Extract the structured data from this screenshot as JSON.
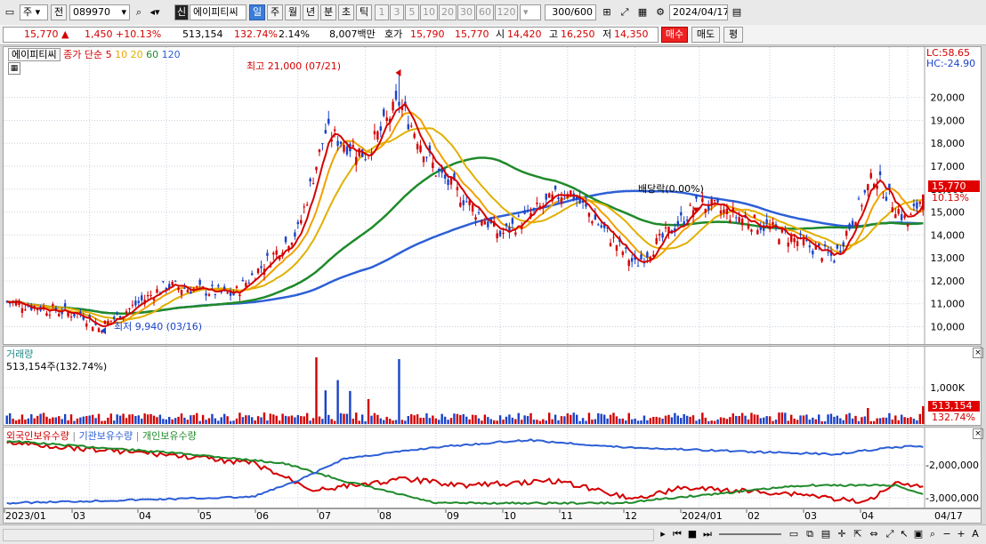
{
  "toolbar": {
    "type_select": "주",
    "prev_label": "전",
    "stock_code": "089970",
    "credit_badge": "신",
    "stock_name": "에이피티씨",
    "periods": [
      "일",
      "주",
      "월",
      "년",
      "분",
      "초",
      "틱"
    ],
    "active_period": "일",
    "minute_steps": [
      "1",
      "3",
      "5",
      "10",
      "20",
      "30",
      "60",
      "120"
    ],
    "count_current": "300",
    "count_total": "/600",
    "date": "2024/04/17"
  },
  "quote": {
    "price": "15,770",
    "change": "1,450",
    "change_pct": "+10.13%",
    "volume": "513,154",
    "volume_ratio": "132.74%",
    "turnover_rate": "2.14%",
    "amount": "8,007백만",
    "ask_label": "호가",
    "ask1": "15,790",
    "bid1": "15,770",
    "open_label": "시",
    "open": "14,420",
    "high_label": "고",
    "high": "16,250",
    "low_label": "저",
    "low": "14,350",
    "buy_label": "매수",
    "sell_label": "매도",
    "eval_label": "평"
  },
  "price_panel": {
    "stock_label": "에이피티씨",
    "ma_title": "종가 단순",
    "ma_periods": [
      {
        "label": "5",
        "color": "#d40000"
      },
      {
        "label": "10",
        "color": "#f2a000"
      },
      {
        "label": "20",
        "color": "#e0b000"
      },
      {
        "label": "60",
        "color": "#1f8a2a"
      },
      {
        "label": "120",
        "color": "#2d5fd6"
      }
    ],
    "lc_label": "LC:58.65",
    "hc_label": "HC:-24.90",
    "high_annotation": "최고 21,000 (07/21)",
    "low_annotation": "최저 9,940 (03/16)",
    "dividend_annotation": "배당락(0.00%)",
    "price_tag": "15,770",
    "pct_tag": "10.13%"
  },
  "volume_panel": {
    "title": "거래량",
    "value_label": "513,154주(132.74%)",
    "tag_value": "513,154",
    "tag_pct": "132.74%"
  },
  "holding_panel": {
    "labels": [
      "외국인보유수량",
      "기관보유수량",
      "개인보유수량"
    ],
    "colors": [
      "#d40000",
      "#2d5fd6",
      "#1f8a2a"
    ]
  },
  "colors": {
    "up": "#d40000",
    "down": "#1a43c8",
    "grid": "#c8d2e0"
  },
  "chart_data": [
    {
      "type": "candlestick",
      "title": "에이피티씨",
      "x_labels": [
        "2023/01",
        "03",
        "04",
        "05",
        "06",
        "07",
        "08",
        "09",
        "10",
        "11",
        "12",
        "2024/01",
        "02",
        "03",
        "04",
        "04/17"
      ],
      "y_ticks": [
        10000,
        11000,
        12000,
        13000,
        14000,
        15000,
        16000,
        17000,
        18000,
        19000,
        20000
      ],
      "ylim": [
        9400,
        21500
      ],
      "closing_path": [
        {
          "x": "2023/01",
          "y": 11100
        },
        {
          "x": "03",
          "y": 10500
        },
        {
          "x": "03/16",
          "y": 9940
        },
        {
          "x": "04",
          "y": 11800
        },
        {
          "x": "05",
          "y": 11400
        },
        {
          "x": "06",
          "y": 14200
        },
        {
          "x": "06-mid",
          "y": 18500
        },
        {
          "x": "07",
          "y": 17500
        },
        {
          "x": "07/21",
          "y": 19800
        },
        {
          "x": "08",
          "y": 16800
        },
        {
          "x": "09",
          "y": 14000
        },
        {
          "x": "10",
          "y": 16000
        },
        {
          "x": "11",
          "y": 12700
        },
        {
          "x": "12",
          "y": 15400
        },
        {
          "x": "2024/01",
          "y": 14300
        },
        {
          "x": "02",
          "y": 13000
        },
        {
          "x": "03",
          "y": 16600
        },
        {
          "x": "04",
          "y": 14500
        },
        {
          "x": "04/17",
          "y": 15770
        }
      ],
      "annotations": {
        "high": 21000,
        "low": 9940,
        "last": 15770
      }
    },
    {
      "type": "bar",
      "title": "거래량",
      "y_ticks": [
        "1,000K"
      ],
      "last_value": 513154
    },
    {
      "type": "line",
      "series": [
        {
          "name": "외국인보유수량",
          "color": "#d40000"
        },
        {
          "name": "기관보유수량",
          "color": "#2d5fd6"
        },
        {
          "name": "개인보유수량",
          "color": "#1f8a2a"
        }
      ],
      "y_ticks": [
        "-2,000,000",
        "-3,000,000"
      ]
    }
  ]
}
